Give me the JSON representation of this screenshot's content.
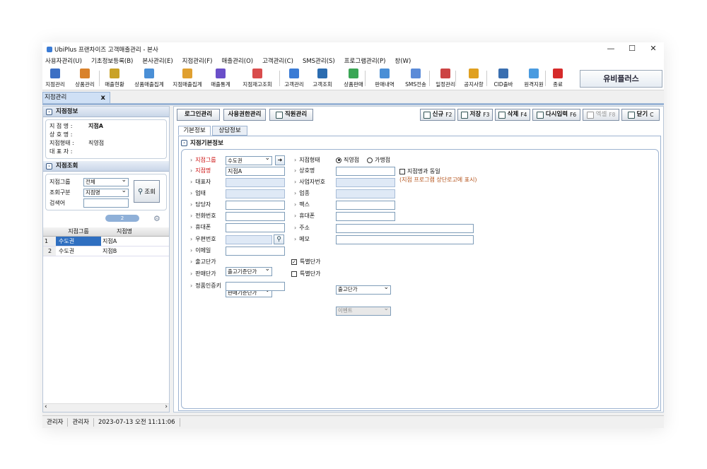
{
  "window": {
    "title": "UbiPlus 프랜차이즈 고객매출관리 - 본사",
    "controls": [
      "—",
      "☐",
      "✕"
    ]
  },
  "menu": [
    "사용자관리(U)",
    "기초정보등록(B)",
    "본사관리(E)",
    "지점관리(F)",
    "매출관리(O)",
    "고객관리(C)",
    "SMS관리(S)",
    "프로그램관리(P)",
    "창(W)"
  ],
  "toolbar": {
    "items": [
      {
        "label": "지점관리",
        "icon": "store-icon",
        "color": "#3b6fc4"
      },
      {
        "label": "상품관리",
        "icon": "box-icon",
        "color": "#d9822b"
      },
      {
        "label": "매출현황",
        "icon": "sales-icon",
        "color": "#c9a227"
      },
      {
        "label": "상품매출집계",
        "icon": "product-sales-icon",
        "color": "#4a8fd6"
      },
      {
        "label": "지점매출집계",
        "icon": "store-sales-icon",
        "color": "#e0a030"
      },
      {
        "label": "매출통계",
        "icon": "chart-icon",
        "color": "#6a4fc9"
      },
      {
        "label": "지점재고조회",
        "icon": "stock-icon",
        "color": "#d94c4c"
      },
      {
        "label": "고객관리",
        "icon": "customer-icon",
        "color": "#3a7bd5"
      },
      {
        "label": "고객조회",
        "icon": "customer-search-icon",
        "color": "#2b6cb0"
      },
      {
        "label": "상품판매",
        "icon": "sell-icon",
        "color": "#3aa655"
      },
      {
        "label": "판매내역",
        "icon": "history-icon",
        "color": "#4a8fd6"
      },
      {
        "label": "SMS전송",
        "icon": "sms-icon",
        "color": "#5b8bd8"
      },
      {
        "label": "일정관리",
        "icon": "calendar-icon",
        "color": "#c44"
      },
      {
        "label": "공지사항",
        "icon": "notice-icon",
        "color": "#e0a020"
      },
      {
        "label": "CID출바",
        "icon": "cid-icon",
        "color": "#3a6fb0"
      },
      {
        "label": "원격지원",
        "icon": "remote-icon",
        "color": "#4a9be0"
      },
      {
        "label": "종료",
        "icon": "exit-icon",
        "color": "#d62a2a"
      }
    ],
    "brand": "유비플러스"
  },
  "doc_tab": {
    "label": "지점관리",
    "close": "x"
  },
  "left": {
    "info_title": "지점정보",
    "info": [
      {
        "k": "지 점 명 :",
        "v": "지점A"
      },
      {
        "k": "상 호 명 :",
        "v": ""
      },
      {
        "k": "지점형태 :",
        "v": "직영점"
      },
      {
        "k": "대 표 자 :",
        "v": ""
      }
    ],
    "search_title": "지점조회",
    "search": {
      "group_label": "지점그룹",
      "group_value": "전체",
      "type_label": "조회구분",
      "type_value": "지점명",
      "keyword_label": "검색어",
      "button": "조회"
    },
    "count": "2",
    "grid_headers": [
      "지점그룹",
      "지점명"
    ],
    "rows": [
      {
        "n": "1",
        "g": "수도권",
        "s": "지점A"
      },
      {
        "n": "2",
        "g": "수도권",
        "s": "지점B"
      }
    ]
  },
  "main": {
    "top_buttons": [
      "로그인관리",
      "사용권한관리",
      "직원관리"
    ],
    "actions": [
      {
        "label": "신규",
        "key": "F2"
      },
      {
        "label": "저장",
        "key": "F3"
      },
      {
        "label": "삭제",
        "key": "F4"
      },
      {
        "label": "다시입력",
        "key": "F6"
      },
      {
        "label": "엑셀",
        "key": "F8"
      },
      {
        "label": "닫기",
        "key": "C"
      }
    ],
    "tabs": [
      "기본정보",
      "상담정보"
    ],
    "section_title": "지점기본정보",
    "left_fields": [
      {
        "label": "지점그룹",
        "value": "수도권",
        "kind": "select",
        "red": true
      },
      {
        "label": "지점명",
        "value": "지점A",
        "kind": "input",
        "red": true
      },
      {
        "label": "대표자",
        "value": "",
        "kind": "dis"
      },
      {
        "label": "업태",
        "value": "",
        "kind": "dis"
      },
      {
        "label": "담당자",
        "value": "",
        "kind": "input"
      },
      {
        "label": "전화번호",
        "value": "",
        "kind": "input"
      },
      {
        "label": "휴대폰",
        "value": "",
        "kind": "input"
      },
      {
        "label": "우편번호",
        "value": "",
        "kind": "zip"
      },
      {
        "label": "이메일",
        "value": "",
        "kind": "input"
      },
      {
        "label": "출고단가",
        "value": "출고기준단가",
        "kind": "select"
      },
      {
        "label": "판매단가",
        "value": "판매기준단가",
        "kind": "select"
      },
      {
        "label": "정품인증키",
        "value": "",
        "kind": "input"
      }
    ],
    "store_type": {
      "label": "지점형태",
      "options": [
        "직영점",
        "가맹점"
      ],
      "selected": "직영점"
    },
    "right_fields": [
      {
        "label": "상호명",
        "value": ""
      },
      {
        "label": "사업자번호",
        "value": ""
      },
      {
        "label": "업종",
        "value": ""
      },
      {
        "label": "팩스",
        "value": ""
      },
      {
        "label": "휴대폰",
        "value": ""
      },
      {
        "label": "주소",
        "value": ""
      },
      {
        "label": "메모",
        "value": ""
      }
    ],
    "same_name": {
      "label": "지점명과 동일",
      "note": "(지점 프로그램 상단로고에 표시)"
    },
    "special1": {
      "label": "특별단가",
      "checked": true,
      "value": "출고단가"
    },
    "special2": {
      "label": "특별단가",
      "checked": false,
      "value": "이벤트"
    }
  },
  "status": [
    "관리자",
    "관리자",
    "2023-07-13 오전 11:11:06"
  ]
}
